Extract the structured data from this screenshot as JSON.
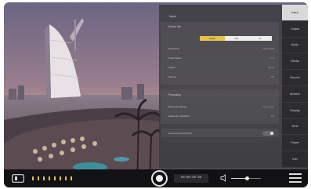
{
  "settings": {
    "title": "Input",
    "source_section": {
      "title": "Source info",
      "source_row": {
        "label": "Source",
        "options": [
          "HDMI",
          "SDI",
          "IP"
        ],
        "selected": "HDMI"
      },
      "rows": [
        {
          "label": "Resolution",
          "value": "1920x1080"
        },
        {
          "label": "Color Space",
          "value": "YUV"
        },
        {
          "label": "Speed",
          "value": "60 fps"
        },
        {
          "label": "Volume",
          "value": "100"
        }
      ]
    },
    "proc_section": {
      "title": "Processing",
      "rows": [
        {
          "label": "Reference Range",
          "value": "Auto range"
        },
        {
          "label": "Reference Subband",
          "value": "Off"
        }
      ]
    },
    "camera_control": {
      "label": "Camera Control (UVC)",
      "enabled": false
    }
  },
  "tabs": [
    "Input",
    "Output",
    "Audio",
    "Media",
    "Record",
    "Monitor",
    "Display",
    "Time",
    "Power",
    "Info"
  ],
  "active_tab": "Input",
  "bottombar": {
    "timecode": "00:00:00:00",
    "volume_level": 0.55,
    "accent": "#e7c24a"
  }
}
